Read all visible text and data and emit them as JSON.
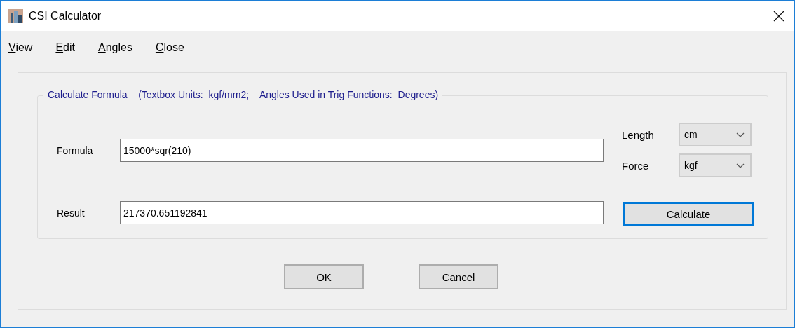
{
  "window": {
    "title": "CSI Calculator"
  },
  "menu": [
    {
      "label": "View"
    },
    {
      "label": "Edit"
    },
    {
      "label": "Angles"
    },
    {
      "label": "Close"
    }
  ],
  "group": {
    "legend": "Calculate Formula    (Textbox Units:  kgf/mm2;    Angles Used in Trig Functions:  Degrees)",
    "fields": [
      {
        "label": "Formula",
        "value": "15000*sqr(210)"
      },
      {
        "label": "Result",
        "value": "217370.651192841"
      }
    ],
    "units": [
      {
        "label": "Length",
        "value": "cm"
      },
      {
        "label": "Force",
        "value": "kgf"
      }
    ],
    "calculate_button": {
      "label": "Calculate",
      "focused": true
    }
  },
  "buttons": [
    {
      "label": "OK"
    },
    {
      "label": "Cancel"
    }
  ]
}
